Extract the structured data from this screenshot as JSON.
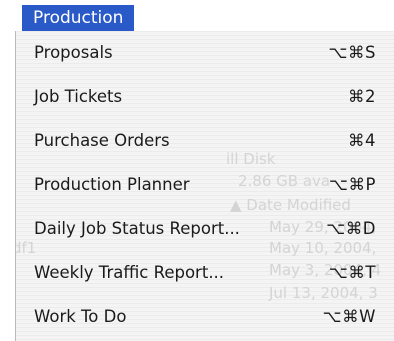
{
  "menu": {
    "title": "Production",
    "items": [
      {
        "label": "Proposals",
        "shortcut": "⌥⌘S"
      },
      {
        "label": "Job Tickets",
        "shortcut": "⌘2"
      },
      {
        "label": "Purchase Orders",
        "shortcut": "⌘4"
      },
      {
        "label": "Production Planner",
        "shortcut": "⌥⌘P"
      },
      {
        "label": "Daily Job Status Report...",
        "shortcut": "⌥⌘D"
      },
      {
        "label": "Weekly Traffic Report...",
        "shortcut": "⌥⌘T"
      },
      {
        "label": "Work To Do",
        "shortcut": "⌥⌘W"
      }
    ]
  },
  "background_window": {
    "text": [
      "ill Disk",
      "2.86 GB ava",
      "▲ Date Modified",
      "May 29, 2004,",
      "df1",
      "May 10, 2004,",
      "May 3, 2004, 4",
      "Jul 13, 2004, 3"
    ]
  },
  "colors": {
    "menu_highlight": "#2a59c8",
    "menu_background": "#f4f4f4",
    "text": "#1a1a1a"
  }
}
